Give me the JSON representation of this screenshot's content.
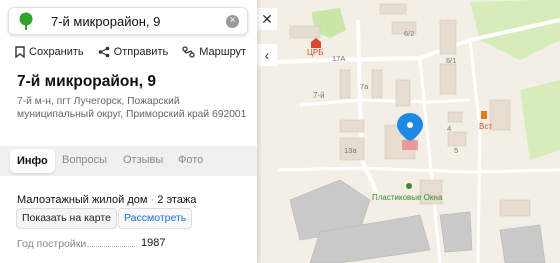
{
  "search": {
    "query": "7-й микрорайон, 9",
    "clear_icon": "clear-icon"
  },
  "actions": [
    {
      "label": "Сохранить",
      "icon": "bookmark-icon"
    },
    {
      "label": "Отправить",
      "icon": "share-icon"
    },
    {
      "label": "Маршрут",
      "icon": "route-icon"
    }
  ],
  "place": {
    "title": "7-й микрорайон, 9",
    "address": "7-й м-н, пгт Лучегорск, Пожарский муниципальный округ, Приморский край 692001"
  },
  "tabs": [
    "Инфо",
    "Вопросы",
    "Отзывы",
    "Фото"
  ],
  "info": {
    "building_type": "Малоэтажный жилой дом",
    "floors": "2 этажа",
    "show_on_map": "Показать на карте",
    "inspect": "Рассмотреть",
    "year_label": "Год постройки",
    "year_value": "1987"
  },
  "side_controls": [
    "close-icon",
    "collapse-left-icon"
  ],
  "map": {
    "labels": {
      "hospital": "ЦРБ",
      "bvst": "Вст",
      "plastic_windows": "Пластиковые Окна",
      "district": "7-й",
      "n62": "6/2",
      "n61": "6/1",
      "n17a": "17А",
      "n7a": "7а",
      "n13a": "13а",
      "n4": "4",
      "n5": "5"
    },
    "colors": {
      "background": "#f3efe6",
      "park": "#c9e6a6",
      "pin": "#1e88e5",
      "poi_green": "#3a8a2b",
      "poi_red": "#d84a2a"
    }
  }
}
